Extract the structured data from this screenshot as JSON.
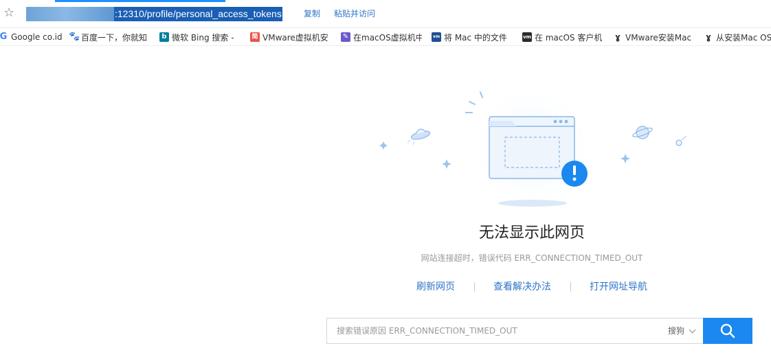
{
  "address_bar": {
    "url_selected": ":12310/profile/personal_access_tokens",
    "copy_label": "复制",
    "paste_visit_label": "粘贴并访问"
  },
  "bookmarks": [
    {
      "label": "Google co.id",
      "icon": "google-icon",
      "color": "#4285f4"
    },
    {
      "label": "百度一下，你就知",
      "icon": "baidu-paw-icon",
      "color": "#2f6ee0"
    },
    {
      "label": "微软 Bing 搜索 -",
      "icon": "bing-icon",
      "color": "#00809d"
    },
    {
      "label": "VMware虚拟机安",
      "icon": "jian-icon",
      "color": "#e8544a"
    },
    {
      "label": "在macOS虚拟机中",
      "icon": "feather-icon",
      "color": "#6a5acd"
    },
    {
      "label": "将 Mac 中的文件",
      "icon": "vmware-icon",
      "color": "#1d4f91"
    },
    {
      "label": "在 macOS 客户机",
      "icon": "vm-icon",
      "color": "#2b2b2b"
    },
    {
      "label": "VMware安装Mac",
      "icon": "v-logo-icon",
      "color": "#333333"
    },
    {
      "label": "从安装Mac OS",
      "icon": "v-logo-icon",
      "color": "#333333"
    }
  ],
  "error": {
    "title": "无法显示此网页",
    "detail": "网站连接超时，错误代码 ERR_CONNECTION_TIMED_OUT",
    "links": {
      "refresh": "刷新网页",
      "solution": "查看解决办法",
      "navigation": "打开网址导航"
    }
  },
  "search": {
    "placeholder": "搜索错误原因 ERR_CONNECTION_TIMED_OUT",
    "engine": "搜狗"
  },
  "colors": {
    "accent": "#1a88f0",
    "link": "#2f74c9",
    "selection": "#1a5fb4"
  }
}
